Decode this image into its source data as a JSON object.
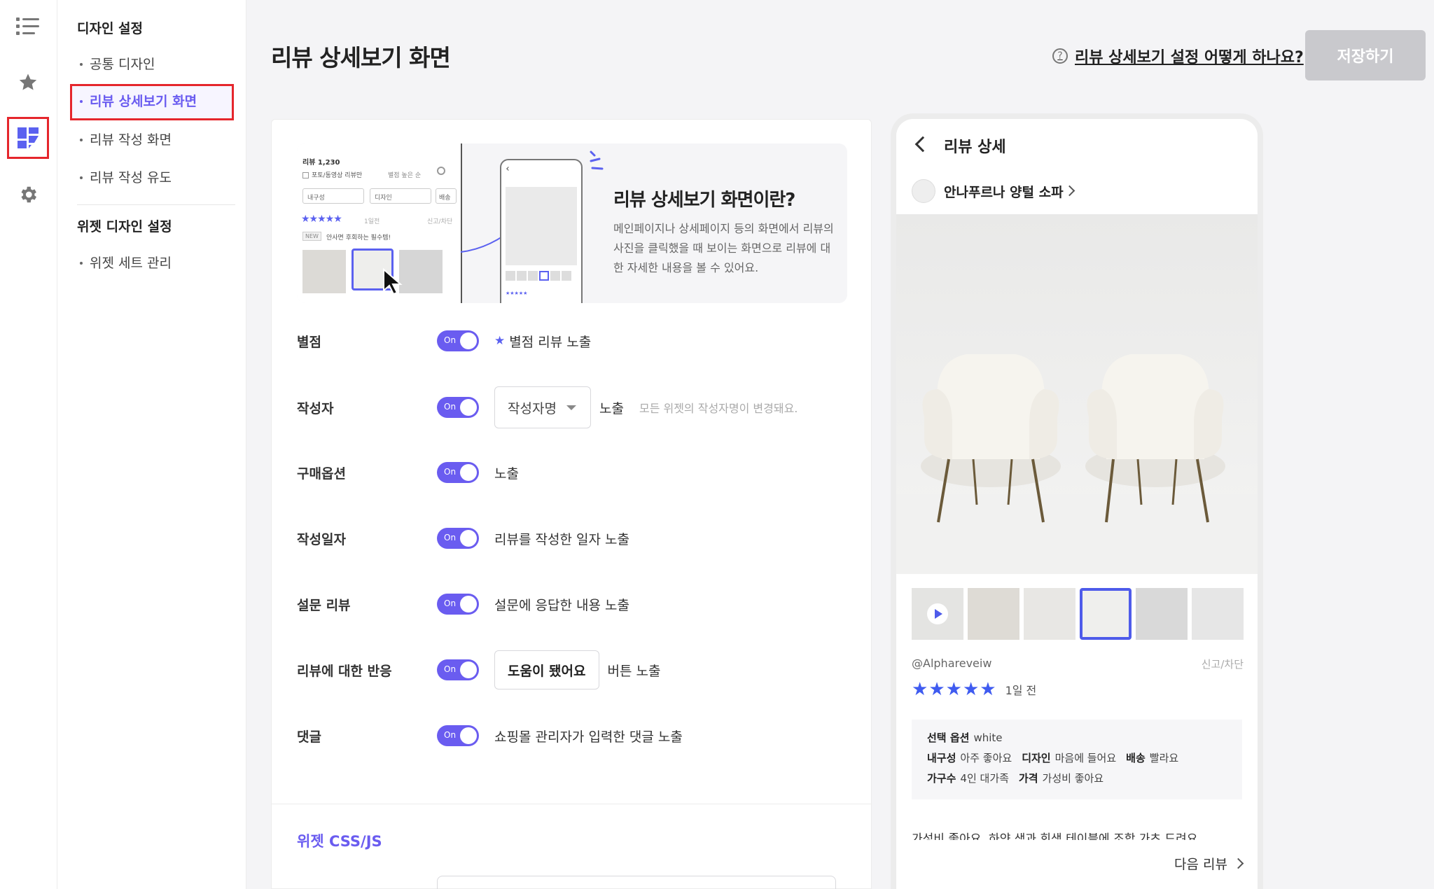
{
  "header": {
    "title": "리뷰 상세보기 화면",
    "help_link": "리뷰 상세보기 설정 어떻게 하나요?",
    "save_label": "저장하기"
  },
  "sidebar": {
    "group1": "디자인 설정",
    "items": [
      "공통 디자인",
      "리뷰 상세보기 화면",
      "리뷰 작성 화면",
      "리뷰 작성 유도"
    ],
    "group2": "위젯 디자인 설정",
    "items2": [
      "위젯 세트 관리"
    ]
  },
  "banner": {
    "title": "리뷰 상세보기 화면이란?",
    "desc": "메인페이지나 상세페이지 등의 화면에서 리뷰의 사진을 클릭했을 때 보이는 화면으로 리뷰에 대한 자세한 내용을 볼 수 있어요.",
    "mock": {
      "count": "리뷰 1,230",
      "filter": "포토/동영상 리뷰만",
      "sort": "별점 높은 순",
      "select1": "내구성",
      "select2": "디자인",
      "select3": "배송",
      "ago": "1일전",
      "report": "신고/차단",
      "new_badge": "NEW",
      "review_line": "안사면 후회하는 필수템!"
    }
  },
  "settings": {
    "toggle_label": "On",
    "rows": [
      {
        "label": "별점",
        "text": "별점 리뷰 노출"
      },
      {
        "label": "작성자",
        "select": "작성자명",
        "text": "노출",
        "hint": "모든 위젯의 작성자명이 변경돼요."
      },
      {
        "label": "구매옵션",
        "text": "노출"
      },
      {
        "label": "작성일자",
        "text": "리뷰를 작성한 일자 노출"
      },
      {
        "label": "설문 리뷰",
        "text": "설문에 응답한 내용 노출"
      },
      {
        "label": "리뷰에 대한 반응",
        "button": "도움이 됐어요",
        "text": "버튼 노출"
      },
      {
        "label": "댓글",
        "text": "쇼핑몰 관리자가 입력한 댓글 노출"
      }
    ],
    "css_title": "위젯 CSS/JS"
  },
  "preview": {
    "title": "리뷰 상세",
    "product": "안나푸르나 양털 소파",
    "user": "@Alphareveiw",
    "report": "신고/차단",
    "ago": "1일 전",
    "rating": 5,
    "options": {
      "selected_label": "선택 옵션",
      "selected_value": "white",
      "k1": "내구성",
      "v1": "아주 좋아요",
      "k2": "디자인",
      "v2": "마음에 들어요",
      "k3": "배송",
      "v3": "빨라요",
      "k4": "가구수",
      "v4": "4인 대가족",
      "k5": "가격",
      "v5": "가성비 좋아요"
    },
    "body": "가성비 좋아요. 하얀 색과 회색 테이블에 조합 가츠 드려요",
    "next": "다음 리뷰"
  },
  "colors": {
    "accent": "#6a5cf0",
    "star": "#3f5bf0",
    "highlight": "#e5262c"
  }
}
